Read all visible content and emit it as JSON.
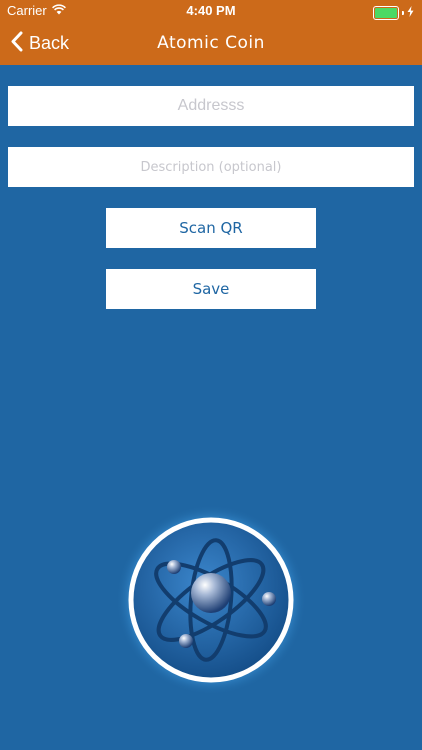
{
  "status_bar": {
    "carrier": "Carrier",
    "time": "4:40 PM",
    "battery_level": 1.0
  },
  "nav": {
    "back_label": "Back",
    "title": "Atomic Coin"
  },
  "form": {
    "address_placeholder": "Addresss",
    "description_placeholder": "Description (optional)",
    "scan_qr_label": "Scan QR",
    "save_label": "Save"
  },
  "colors": {
    "header": "#cc6a1a",
    "background": "#1f66a3",
    "button_text": "#1f66a3",
    "battery": "#4cd964"
  },
  "logo": {
    "icon": "atom-logo-icon"
  }
}
